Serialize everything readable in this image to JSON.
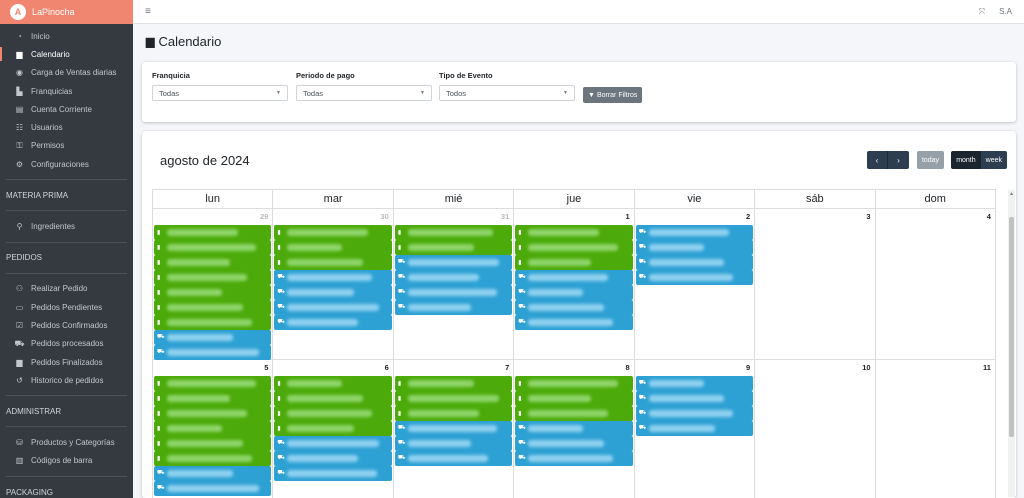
{
  "brand": {
    "name": "LaPinocha",
    "logo_letter": "A"
  },
  "sidebar": {
    "main": [
      {
        "label": "Inicio",
        "icon": "◔"
      },
      {
        "label": "Calendario",
        "icon": "▆",
        "active": true
      },
      {
        "label": "Carga de Ventas diarias",
        "icon": "◉"
      },
      {
        "label": "Franquicias",
        "icon": "▙"
      },
      {
        "label": "Cuenta Corriente",
        "icon": "▤"
      },
      {
        "label": "Usuarios",
        "icon": "☷"
      },
      {
        "label": "Permisos",
        "icon": "⚿"
      },
      {
        "label": "Configuraciones",
        "icon": "⚙"
      }
    ],
    "materia_header": "MATERIA PRIMA",
    "materia": [
      {
        "label": "Ingredientes",
        "icon": "⚲"
      }
    ],
    "pedidos_header": "PEDIDOS",
    "pedidos": [
      {
        "label": "Realizar Pedido",
        "icon": "⚇"
      },
      {
        "label": "Pedidos Pendientes",
        "icon": "▭"
      },
      {
        "label": "Pedidos Confirmados",
        "icon": "☑"
      },
      {
        "label": "Pedidos procesados",
        "icon": "⛟"
      },
      {
        "label": "Pedidos Finalizados",
        "icon": "▆"
      },
      {
        "label": "Historico de pedidos",
        "icon": "↺"
      }
    ],
    "admin_header": "ADMINISTRAR",
    "admin": [
      {
        "label": "Productos y Categorías",
        "icon": "⛁"
      },
      {
        "label": "Códigos de barra",
        "icon": "▥"
      }
    ],
    "packaging_header": "PACKAGING"
  },
  "topbar": {
    "menu_icon": "≡",
    "expand_icon": "⤧",
    "user": "S.A"
  },
  "page": {
    "title": "Calendario",
    "title_icon": "▆"
  },
  "filters": {
    "franquicia": {
      "label": "Franquicia",
      "value": "Todas"
    },
    "periodo": {
      "label": "Periodo de pago",
      "value": "Todas"
    },
    "evento": {
      "label": "Tipo de Evento",
      "value": "Todos"
    },
    "clear_button": "Borrar Filtros"
  },
  "calendar": {
    "title": "agosto de 2024",
    "prev": "‹",
    "next": "›",
    "today": "today",
    "view_month": "month",
    "view_week": "week",
    "days": [
      "lun",
      "mar",
      "mié",
      "jue",
      "vie",
      "sáb",
      "dom"
    ],
    "weeks": [
      {
        "days": [
          {
            "num": "29",
            "other": true,
            "events": [
              "g",
              "g",
              "g",
              "g",
              "g",
              "g",
              "g",
              "b",
              "b"
            ]
          },
          {
            "num": "30",
            "other": true,
            "events": [
              "g",
              "g",
              "g",
              "b",
              "b",
              "b",
              "b"
            ]
          },
          {
            "num": "31",
            "other": true,
            "events": [
              "g",
              "g",
              "b",
              "b",
              "b",
              "b"
            ]
          },
          {
            "num": "1",
            "events": [
              "g",
              "g",
              "g",
              "b",
              "b",
              "b",
              "b"
            ]
          },
          {
            "num": "2",
            "events": [
              "b",
              "b",
              "b",
              "b"
            ]
          },
          {
            "num": "3",
            "events": []
          },
          {
            "num": "4",
            "events": []
          }
        ]
      },
      {
        "days": [
          {
            "num": "5",
            "events": [
              "g",
              "g",
              "g",
              "g",
              "g",
              "g",
              "b",
              "b"
            ]
          },
          {
            "num": "6",
            "events": [
              "g",
              "g",
              "g",
              "g",
              "b",
              "b",
              "b"
            ]
          },
          {
            "num": "7",
            "events": [
              "g",
              "g",
              "g",
              "b",
              "b",
              "b"
            ]
          },
          {
            "num": "8",
            "events": [
              "g",
              "g",
              "g",
              "b",
              "b",
              "b"
            ]
          },
          {
            "num": "9",
            "events": [
              "b",
              "b",
              "b",
              "b"
            ]
          },
          {
            "num": "10",
            "events": []
          },
          {
            "num": "11",
            "events": []
          }
        ]
      }
    ]
  },
  "colors": {
    "accent": "#f08570",
    "event_green": "#4caa0a",
    "event_blue": "#2ea1d4",
    "sidebar": "#343a40"
  }
}
